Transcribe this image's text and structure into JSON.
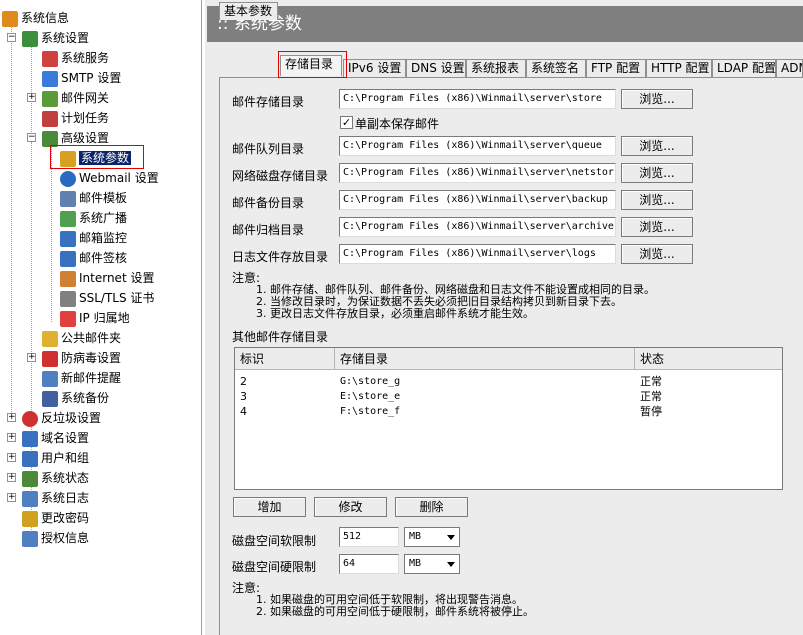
{
  "sidebar": {
    "items": [
      {
        "label": "系统信息",
        "icon": "system-info-icon",
        "color": "#e08a1e"
      },
      {
        "label": "系统设置",
        "icon": "system-settings-icon",
        "color": "#3c8f3c"
      },
      {
        "label": "系统服务",
        "icon": "service-icon",
        "color": "#d04040"
      },
      {
        "label": "SMTP 设置",
        "icon": "smtp-icon",
        "color": "#3a7ad8"
      },
      {
        "label": "邮件网关",
        "icon": "gateway-icon",
        "color": "#5a9a3a"
      },
      {
        "label": "计划任务",
        "icon": "schedule-icon",
        "color": "#c04040"
      },
      {
        "label": "高级设置",
        "icon": "advanced-icon",
        "color": "#4a8a3a"
      },
      {
        "label": "系统参数",
        "icon": "parameters-icon",
        "color": "#d8a020"
      },
      {
        "label": "Webmail 设置",
        "icon": "webmail-icon",
        "color": "#2a6ac0"
      },
      {
        "label": "邮件模板",
        "icon": "template-icon",
        "color": "#6080b0"
      },
      {
        "label": "系统广播",
        "icon": "broadcast-icon",
        "color": "#50a050"
      },
      {
        "label": "邮箱监控",
        "icon": "monitor-icon",
        "color": "#3a70c0"
      },
      {
        "label": "邮件签核",
        "icon": "approval-icon",
        "color": "#3a70c0"
      },
      {
        "label": "Internet 设置",
        "icon": "internet-icon",
        "color": "#d08030"
      },
      {
        "label": "SSL/TLS 证书",
        "icon": "certificate-icon",
        "color": "#808080"
      },
      {
        "label": "IP 归属地",
        "icon": "ip-location-icon",
        "color": "#e04040"
      },
      {
        "label": "公共邮件夹",
        "icon": "public-folder-icon",
        "color": "#e0b030"
      },
      {
        "label": "防病毒设置",
        "icon": "antivirus-icon",
        "color": "#d03030"
      },
      {
        "label": "新邮件提醒",
        "icon": "new-mail-icon",
        "color": "#5080c0"
      },
      {
        "label": "系统备份",
        "icon": "backup-icon",
        "color": "#4060a0"
      },
      {
        "label": "反垃圾设置",
        "icon": "antispam-icon",
        "color": "#d03030"
      },
      {
        "label": "域名设置",
        "icon": "domain-icon",
        "color": "#3a70c0"
      },
      {
        "label": "用户和组",
        "icon": "users-icon",
        "color": "#3a70c0"
      },
      {
        "label": "系统状态",
        "icon": "status-icon",
        "color": "#4a8a3a"
      },
      {
        "label": "系统日志",
        "icon": "log-icon",
        "color": "#5080c0"
      },
      {
        "label": "更改密码",
        "icon": "password-icon",
        "color": "#d0a020"
      },
      {
        "label": "授权信息",
        "icon": "license-icon",
        "color": "#5080c0"
      }
    ]
  },
  "header": {
    "title": ":: 系统参数"
  },
  "tabs": [
    {
      "label": "基本参数"
    },
    {
      "label": "存储目录"
    },
    {
      "label": "IPv6 设置"
    },
    {
      "label": "DNS 设置"
    },
    {
      "label": "系统报表"
    },
    {
      "label": "系统签名"
    },
    {
      "label": "FTP 配置"
    },
    {
      "label": "HTTP 配置"
    },
    {
      "label": "LDAP 配置"
    },
    {
      "label": "ADM"
    }
  ],
  "storage": {
    "browse_label": "浏览...",
    "mail_store": {
      "label": "邮件存储目录",
      "value": "C:\\Program Files (x86)\\Winmail\\server\\store"
    },
    "single_copy": {
      "label": "单副本保存邮件",
      "checked": true
    },
    "queue": {
      "label": "邮件队列目录",
      "value": "C:\\Program Files (x86)\\Winmail\\server\\queue"
    },
    "netstore": {
      "label": "网络磁盘存储目录",
      "value": "C:\\Program Files (x86)\\Winmail\\server\\netstor"
    },
    "backup": {
      "label": "邮件备份目录",
      "value": "C:\\Program Files (x86)\\Winmail\\server\\backup"
    },
    "archive": {
      "label": "邮件归档目录",
      "value": "C:\\Program Files (x86)\\Winmail\\server\\archive"
    },
    "logs": {
      "label": "日志文件存放目录",
      "value": "C:\\Program Files (x86)\\Winmail\\server\\logs"
    }
  },
  "notes1": {
    "title": "注意:",
    "lines": [
      "1. 邮件存储、邮件队列、邮件备份、网络磁盘和日志文件不能设置成相同的目录。",
      "2. 当修改目录时，为保证数据不丢失必须把旧目录结构拷贝到新目录下去。",
      "3. 更改日志文件存放目录，必须重启邮件系统才能生效。"
    ]
  },
  "other_storage": {
    "title": "其他邮件存储目录",
    "headers": [
      "标识",
      "存储目录",
      "状态"
    ],
    "rows": [
      {
        "id": "2",
        "path": "G:\\store_g",
        "status": "正常"
      },
      {
        "id": "3",
        "path": "E:\\store_e",
        "status": "正常"
      },
      {
        "id": "4",
        "path": "F:\\store_f",
        "status": "暂停"
      }
    ]
  },
  "actions": {
    "add": "增加",
    "edit": "修改",
    "delete": "删除"
  },
  "limits": {
    "soft": {
      "label": "磁盘空间软限制",
      "value": "512",
      "unit": "MB"
    },
    "hard": {
      "label": "磁盘空间硬限制",
      "value": "64",
      "unit": "MB"
    }
  },
  "notes2": {
    "title": "注意:",
    "lines": [
      "1. 如果磁盘的可用空间低于软限制，将出现警告消息。",
      "2. 如果磁盘的可用空间低于硬限制，邮件系统将被停止。"
    ]
  }
}
